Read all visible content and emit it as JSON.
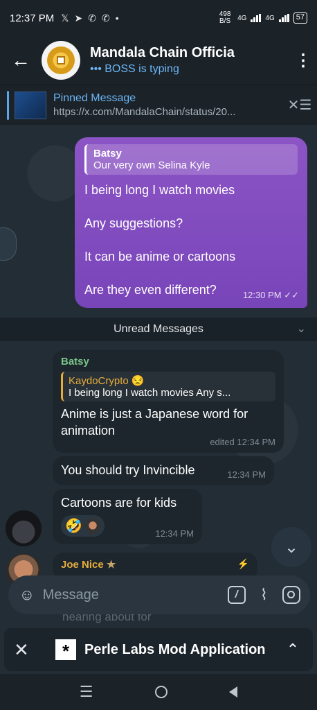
{
  "status_bar": {
    "time": "12:37 PM",
    "notification_icons": [
      "x-icon",
      "telegram-icon",
      "whatsapp-icon",
      "whatsapp-icon",
      "dot-icon"
    ],
    "data_rate": "498 B/S",
    "network_1": "4G",
    "network_2": "4G",
    "battery": "57"
  },
  "header": {
    "back_icon": "←",
    "title": "Mandala Chain Officia",
    "subtitle": "••• BOSS is typing",
    "menu_icon": "⋮"
  },
  "pinned": {
    "title": "Pinned Message",
    "text": "https://x.com/MandalaChain/status/20..."
  },
  "outgoing": {
    "reply_name": "Batsy",
    "reply_text": "Our very own Selina Kyle",
    "lines": [
      "I being long I watch movies",
      "Any suggestions?",
      "It can be anime or  cartoons",
      "Are they even different?"
    ],
    "time": "12:30 PM ✓✓"
  },
  "unread": {
    "label": "Unread Messages"
  },
  "incoming": {
    "sender": "Batsy",
    "quote_name": "KaydoCrypto 😒",
    "quote_text": "I being long I watch movies   Any s...",
    "msg1_text": "Anime is just a Japanese word for animation",
    "msg1_meta": "edited 12:34 PM",
    "msg2_text": "You should try Invincible",
    "msg2_meta": "12:34 PM",
    "msg3_text": "Cartoons are for kids",
    "msg3_meta": "12:34 PM",
    "reaction_emoji": "🤣"
  },
  "joe": {
    "name": "Joe Nice",
    "name_badge": "★",
    "bolt": "⚡",
    "behind_text": "hearing about for"
  },
  "composer": {
    "placeholder": "Message"
  },
  "mini_app": {
    "title": "Perle Labs Mod Application",
    "logo": "*"
  },
  "colors": {
    "outgoing_bubble": "#8c54c5",
    "accent": "#6cb6f5",
    "sender_green": "#79c48a",
    "quote_orange": "#e7ad3c"
  }
}
